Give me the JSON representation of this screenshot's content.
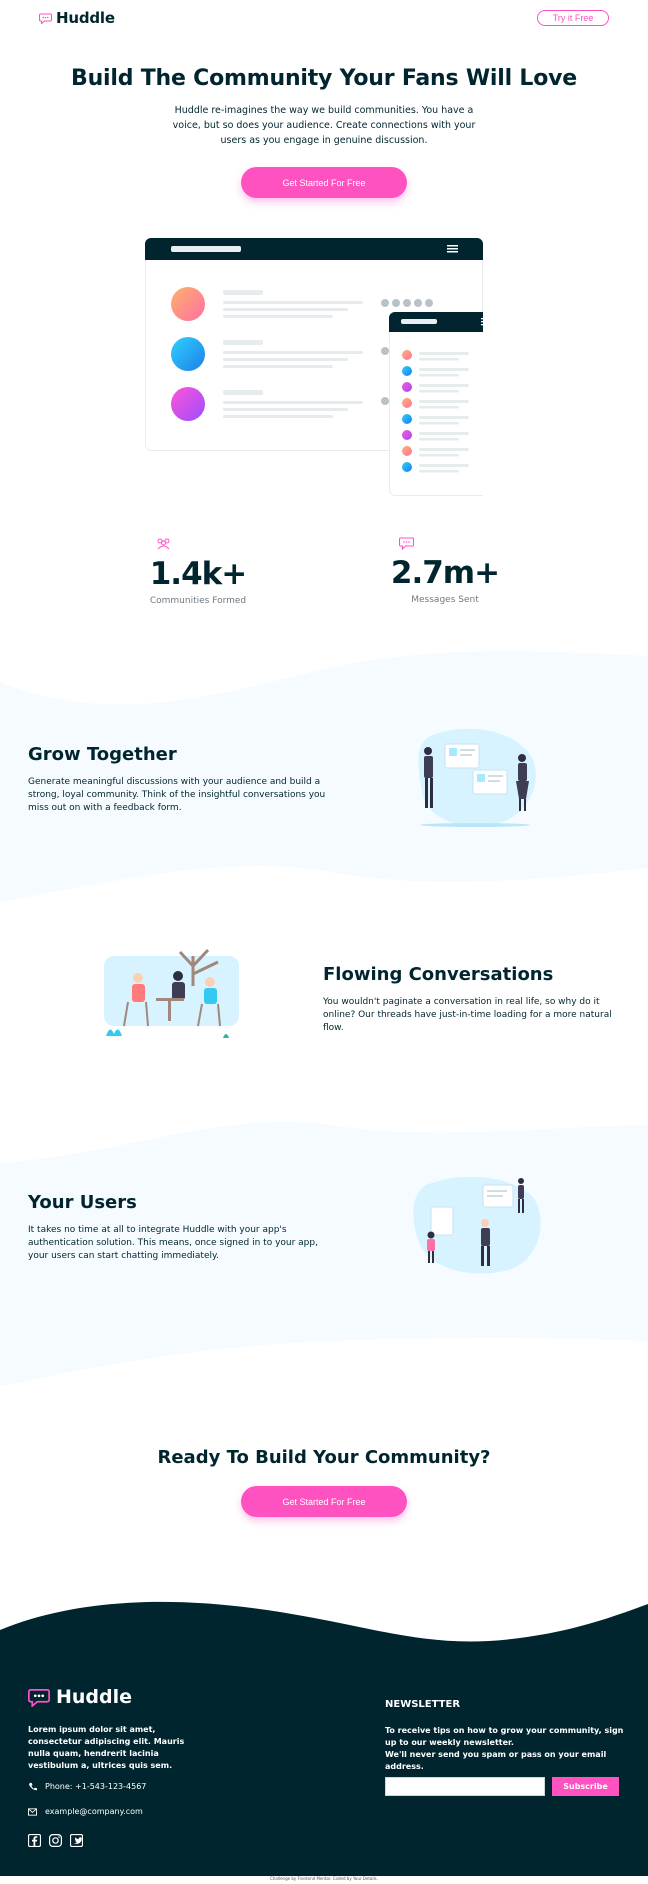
{
  "header": {
    "logo_text": "Huddle",
    "try_button": "Try it Free"
  },
  "hero": {
    "title": "Build The Community Your Fans Will Love",
    "text": "Huddle re-imagines the way we build communities. You have a voice, but so does your audience. Create connections with your users as you engage in genuine discussion.",
    "cta": "Get Started For Free"
  },
  "stats": [
    {
      "value": "1.4k+",
      "label": "Communities Formed",
      "icon": "communities-icon"
    },
    {
      "value": "2.7m+",
      "label": "Messages Sent",
      "icon": "messages-icon"
    }
  ],
  "features": [
    {
      "title": "Grow Together",
      "text": "Generate meaningful discussions with your audience and build a strong, loyal community. Think of the insightful conversations you miss out on with a feedback form."
    },
    {
      "title": "Flowing Conversations",
      "text": "You wouldn't paginate a conversation in real life, so why do it online? Our threads have just-in-time loading for a more natural flow."
    },
    {
      "title": "Your Users",
      "text": "It takes no time at all to integrate Huddle with your app's authentication solution. This means, once signed in to your app, your users can start chatting immediately."
    }
  ],
  "ready": {
    "title": "Ready To Build Your Community?",
    "cta": "Get Started For Free"
  },
  "footer": {
    "logo_text": "Huddle",
    "about": "Lorem ipsum dolor sit amet, consectetur adipiscing elit. Mauris nulla quam, hendrerit lacinia vestibulum a, ultrices quis sem.",
    "phone": "Phone: +1-543-123-4567",
    "email": "example@company.com",
    "newsletter_title": "NEWSLETTER",
    "newsletter_text_1": "To receive tips on how to grow your community, sign up to our weekly newsletter.",
    "newsletter_text_2": "We'll never send you spam or pass on your email address.",
    "subscribe": "Subscribe",
    "socials": [
      "facebook-icon",
      "instagram-icon",
      "twitter-icon"
    ],
    "attribution": "Challenge by Frontend Mentor. Coded by Your Details."
  },
  "colors": {
    "accent": "#ff52c1",
    "dark": "#00252e",
    "light_bg": "#f5fbff"
  }
}
